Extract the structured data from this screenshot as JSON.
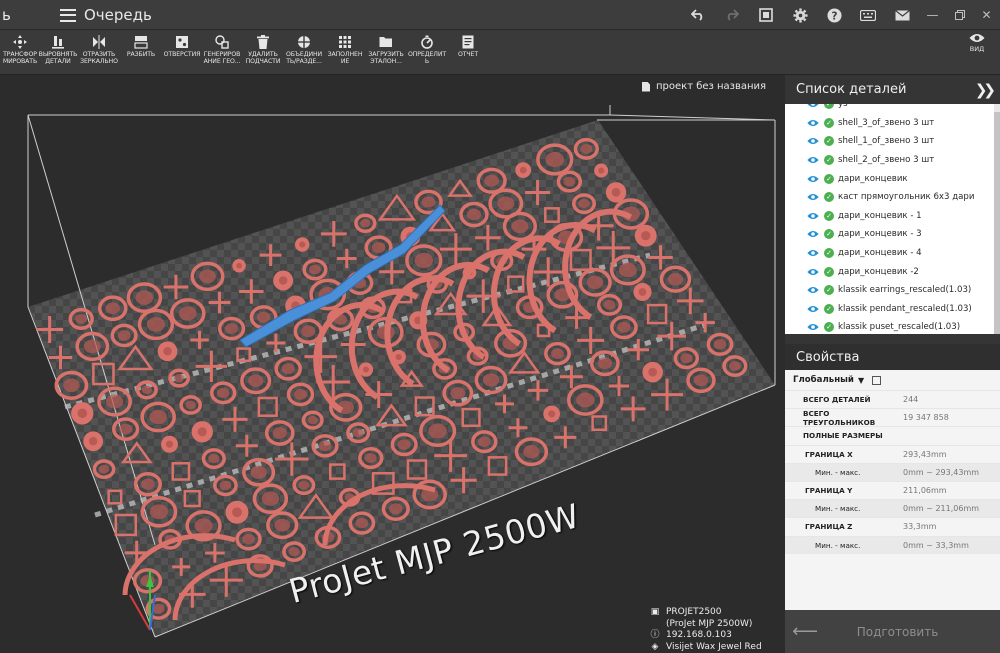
{
  "titlebar": {
    "prev_tab": "ь",
    "title": "Очередь"
  },
  "toolbar": [
    {
      "icon": "transform-icon",
      "label": "ТРАНСФОР\nМИРОВАТЬ"
    },
    {
      "icon": "align-icon",
      "label": "ВЫРОВНЯТЬ\nДЕТАЛИ"
    },
    {
      "icon": "mirror-icon",
      "label": "ОТРАЗИТЬ\nЗЕРКАЛЬНО"
    },
    {
      "icon": "split-icon",
      "label": "РАЗБИТЬ"
    },
    {
      "icon": "holes-icon",
      "label": "ОТВЕРСТИЯ"
    },
    {
      "icon": "generate-icon",
      "label": "ГЕНЕРИРОВ\nАНИЕ ГЕО..."
    },
    {
      "icon": "trash-icon",
      "label": "УДАЛИТЬ\nПОДЧАСТИ"
    },
    {
      "icon": "merge-icon",
      "label": "ОБЪЕДИНИ\nТЬ/РАЗДЕ..."
    },
    {
      "icon": "fill-icon",
      "label": "ЗАПОЛНЕН\nИЕ"
    },
    {
      "icon": "folder-icon",
      "label": "ЗАГРУЗИТЬ\nЭТАЛОН..."
    },
    {
      "icon": "detect-icon",
      "label": "ОПРЕДЕЛИТ\nЬ"
    },
    {
      "icon": "report-icon",
      "label": "ОТЧЕТ"
    }
  ],
  "view_label": "ВИД",
  "viewport": {
    "project_name": "проект без названия",
    "watermark": "ProJet MJP 2500W",
    "printer_id": "PROJET2500",
    "printer_model": "(ProJet MJP 2500W)",
    "ip": "192.168.0.103",
    "material": "Visijet Wax Jewel Red"
  },
  "parts_panel": {
    "title": "Список деталей",
    "items": [
      "ys",
      "shell_3_of_звено 3 шт",
      "shell_1_of_звено 3 шт",
      "shell_2_of_звено 3 шт",
      "дари_концевик",
      "каст прямоугольник 6х3 дари",
      "дари_концевик - 1",
      "дари_концевик - 3",
      "дари_концевик - 4",
      "дари_концевик -2",
      "klassik earrings_rescaled(1.03)",
      "klassik pendant_rescaled(1.03)",
      "klassik puset_rescaled(1.03)"
    ]
  },
  "props_panel": {
    "title": "Свойства",
    "scope": "Глобальный",
    "rows": [
      {
        "k": "ВСЕГО ДЕТАЛЕЙ",
        "v": "244",
        "lvl": 0
      },
      {
        "k": "ВСЕГО ТРЕУГОЛЬНИКОВ",
        "v": "19 347 858",
        "lvl": 0
      },
      {
        "k": "ПОЛНЫЕ РАЗМЕРЫ",
        "v": "",
        "lvl": 0
      },
      {
        "k": "ГРАНИЦА X",
        "v": "293,43mm",
        "lvl": 1
      },
      {
        "k": "Мин. - макс.",
        "v": "0mm ~ 293,43mm",
        "lvl": 2
      },
      {
        "k": "ГРАНИЦА Y",
        "v": "211,06mm",
        "lvl": 1
      },
      {
        "k": "Мин. - макс.",
        "v": "0mm ~ 211,06mm",
        "lvl": 2
      },
      {
        "k": "ГРАНИЦА Z",
        "v": "33,3mm",
        "lvl": 1
      },
      {
        "k": "Мин. - макс.",
        "v": "0mm ~ 33,3mm",
        "lvl": 2
      }
    ],
    "prepare_label": "Подготовить"
  },
  "colors": {
    "model": "#d9726a",
    "model_dark": "#b85a54",
    "selected": "#4a90d9",
    "check": "#4caf50"
  }
}
